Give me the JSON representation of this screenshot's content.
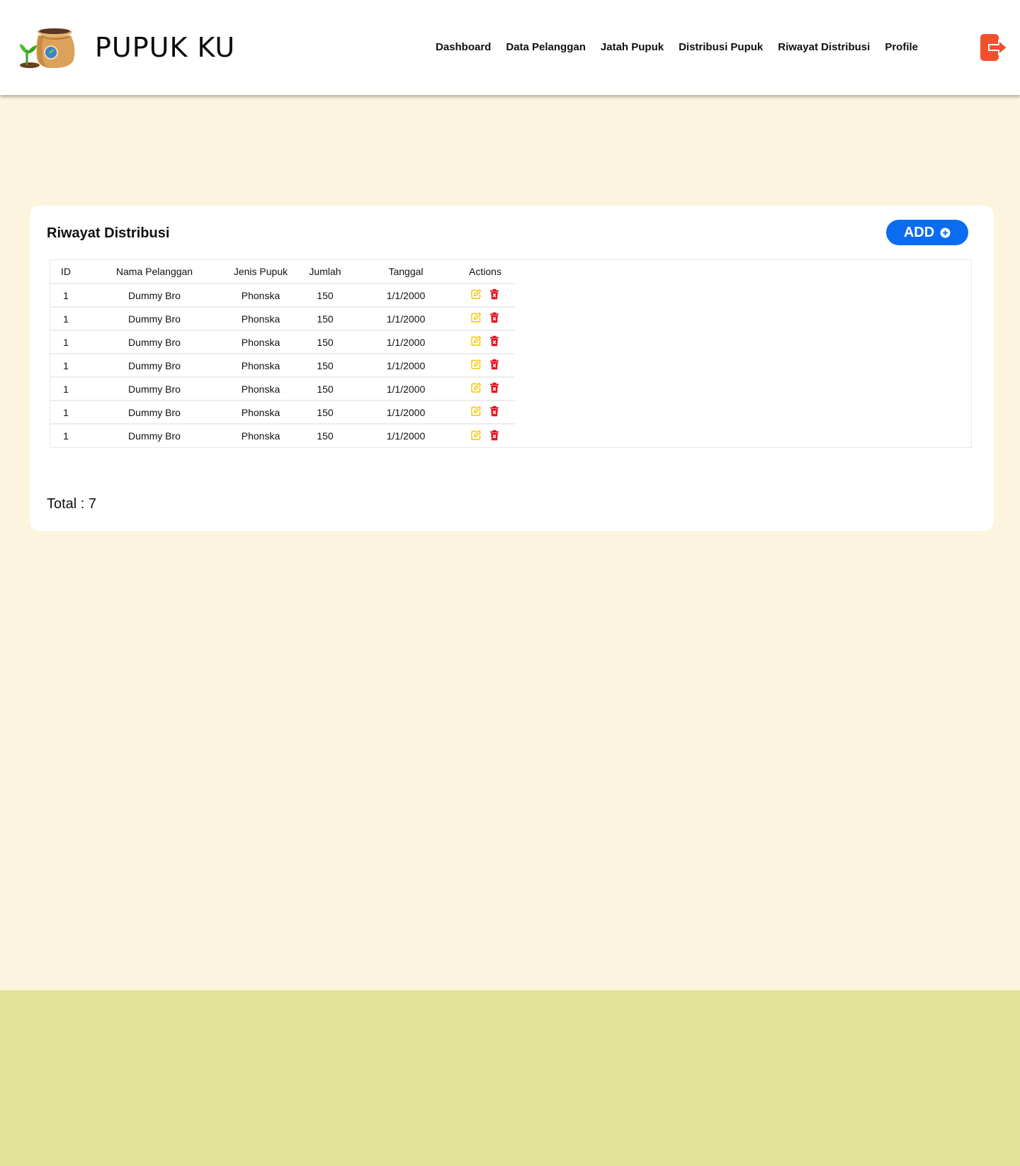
{
  "brand": {
    "title": "PUPUK KU",
    "logo_icon": "fertilizer-sack-icon"
  },
  "nav": {
    "items": [
      {
        "label": "Dashboard"
      },
      {
        "label": "Data Pelanggan"
      },
      {
        "label": "Jatah Pupuk"
      },
      {
        "label": "Distribusi Pupuk"
      },
      {
        "label": "Riwayat Distribusi"
      },
      {
        "label": "Profile"
      }
    ],
    "logout_icon": "logout-icon"
  },
  "card": {
    "title": "Riwayat Distribusi",
    "add_label": "ADD",
    "add_icon": "plus-circle-icon",
    "total": "Total : 7"
  },
  "table": {
    "headers": {
      "id": "ID",
      "nama": "Nama Pelanggan",
      "jenis": "Jenis Pupuk",
      "jumlah": "Jumlah",
      "tanggal": "Tanggal",
      "actions": "Actions"
    },
    "rows": [
      {
        "id": "1",
        "nama": "Dummy Bro",
        "jenis": "Phonska",
        "jumlah": "150",
        "tanggal": "1/1/2000"
      },
      {
        "id": "1",
        "nama": "Dummy Bro",
        "jenis": "Phonska",
        "jumlah": "150",
        "tanggal": "1/1/2000"
      },
      {
        "id": "1",
        "nama": "Dummy Bro",
        "jenis": "Phonska",
        "jumlah": "150",
        "tanggal": "1/1/2000"
      },
      {
        "id": "1",
        "nama": "Dummy Bro",
        "jenis": "Phonska",
        "jumlah": "150",
        "tanggal": "1/1/2000"
      },
      {
        "id": "1",
        "nama": "Dummy Bro",
        "jenis": "Phonska",
        "jumlah": "150",
        "tanggal": "1/1/2000"
      },
      {
        "id": "1",
        "nama": "Dummy Bro",
        "jenis": "Phonska",
        "jumlah": "150",
        "tanggal": "1/1/2000"
      },
      {
        "id": "1",
        "nama": "Dummy Bro",
        "jenis": "Phonska",
        "jumlah": "150",
        "tanggal": "1/1/2000"
      }
    ],
    "edit_icon": "edit-icon",
    "delete_icon": "trash-icon"
  },
  "colors": {
    "page_bg": "#fcf4de",
    "footer_band": "#e1e397",
    "accent_blue": "#0b6cf2",
    "edit_yellow": "#f5c400",
    "delete_red": "#e3101a",
    "logout_orange": "#f1502f"
  }
}
